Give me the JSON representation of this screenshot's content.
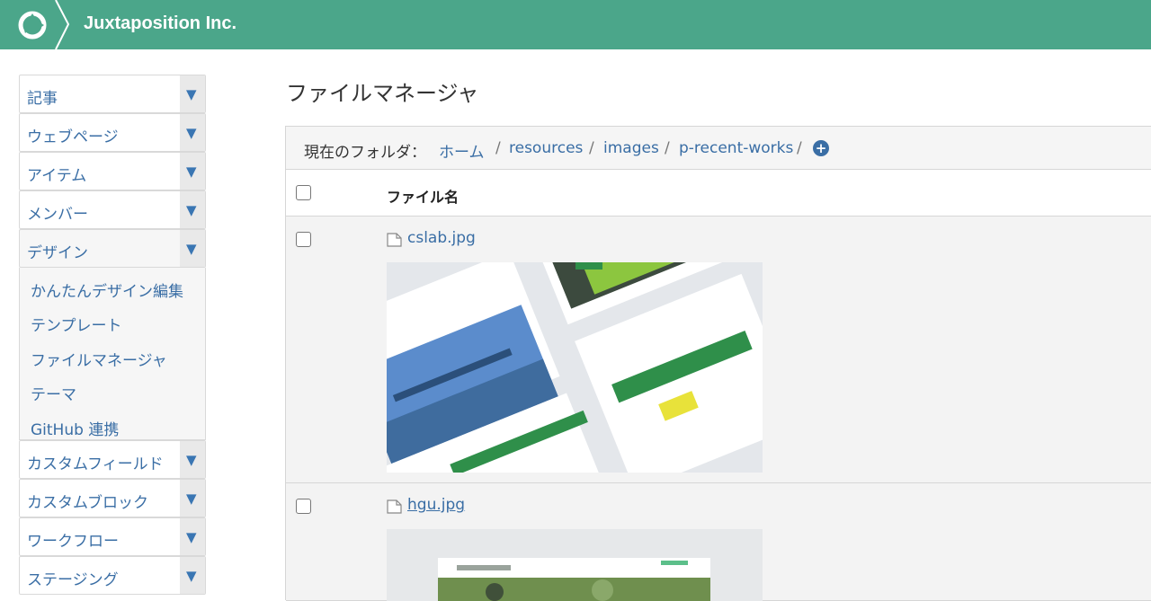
{
  "header": {
    "brand": "Juxtaposition Inc.",
    "logo_icon": "juxtaposition-logo-icon"
  },
  "sidebar": {
    "items": [
      {
        "label": "記事"
      },
      {
        "label": "ウェブページ"
      },
      {
        "label": "アイテム"
      },
      {
        "label": "メンバー"
      },
      {
        "label": "デザイン"
      }
    ],
    "design_sub": [
      {
        "label": "かんたんデザイン編集"
      },
      {
        "label": "テンプレート"
      },
      {
        "label": "ファイルマネージャ"
      },
      {
        "label": "テーマ"
      },
      {
        "label": "GitHub 連携"
      }
    ],
    "items_after": [
      {
        "label": "カスタムフィールド"
      },
      {
        "label": "カスタムブロック"
      },
      {
        "label": "ワークフロー"
      },
      {
        "label": "ステージング"
      }
    ],
    "arrow_glyph": "▼"
  },
  "main": {
    "title": "ファイルマネージャ",
    "breadcrumb": {
      "current_label": "現在のフォルダ：",
      "parts": [
        "ホーム",
        "resources",
        "images",
        "p-recent-works"
      ],
      "separator": "/"
    },
    "table": {
      "column": "ファイル名",
      "rows": [
        {
          "name": "cslab.jpg"
        },
        {
          "name": "hgu.jpg"
        }
      ]
    }
  },
  "colors": {
    "header": "#4ba68a",
    "link": "#3a6ea5"
  }
}
